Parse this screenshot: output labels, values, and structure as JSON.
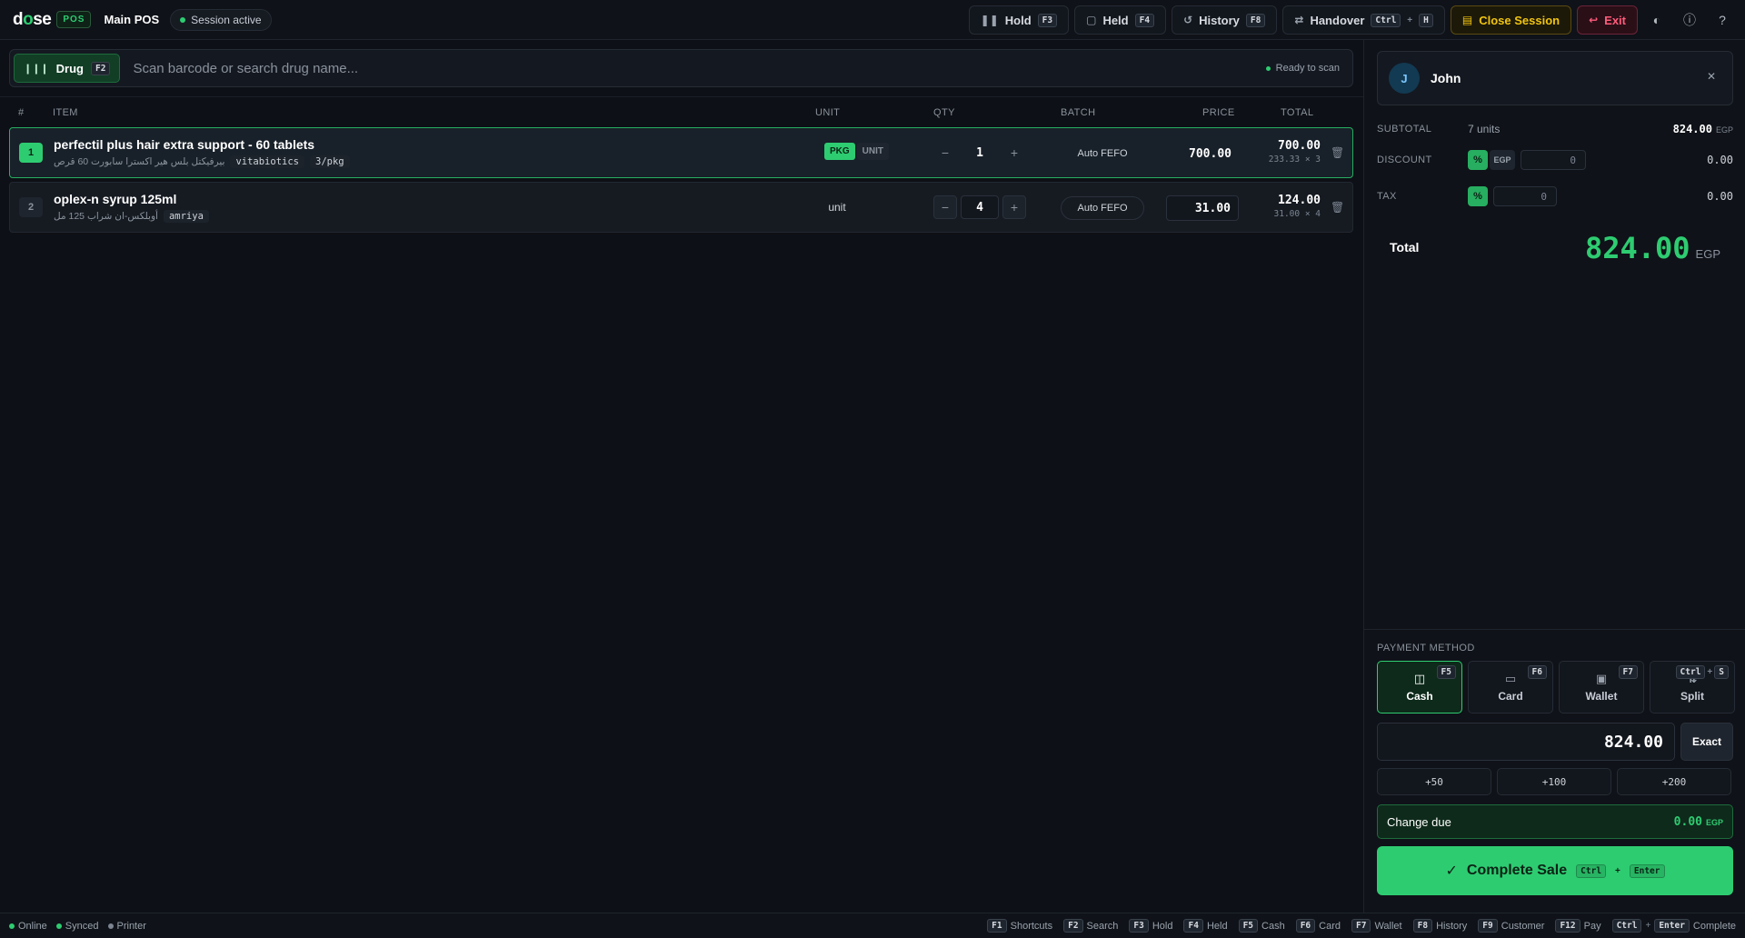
{
  "header": {
    "logo_pre": "d",
    "logo_o": "o",
    "logo_post": "se",
    "pos_badge": "POS",
    "title": "Main POS",
    "session": "Session active",
    "actions": {
      "hold": {
        "label": "Hold",
        "key": "F3"
      },
      "held": {
        "label": "Held",
        "key": "F4"
      },
      "history": {
        "label": "History",
        "key": "F8"
      },
      "handover": {
        "label": "Handover",
        "key1": "Ctrl",
        "plus": "+",
        "key2": "H"
      },
      "close_session": {
        "label": "Close Session"
      },
      "exit": {
        "label": "Exit"
      }
    }
  },
  "search": {
    "mode_label": "Drug",
    "mode_key": "F2",
    "placeholder": "Scan barcode or search drug name...",
    "status": "Ready to scan"
  },
  "table": {
    "headers": {
      "num": "#",
      "item": "ITEM",
      "unit": "UNIT",
      "qty": "QTY",
      "batch": "BATCH",
      "price": "PRICE",
      "total": "TOTAL"
    },
    "rows": [
      {
        "index": "1",
        "name": "perfectil plus hair extra support - 60 tablets",
        "arabic": "بيرفيكتل بلس هير اكسترا سابورت 60 قرص",
        "manufacturer": "vitabiotics",
        "pack": "3/pkg",
        "unit_on": "PKG",
        "unit_off": "UNIT",
        "qty": "1",
        "batch": "Auto FEFO",
        "price": "700.00",
        "total": "700.00",
        "breakdown": "233.33 × 3"
      },
      {
        "index": "2",
        "name": "oplex-n syrup 125ml",
        "arabic": "أوبلكس-ان شراب 125 مل",
        "manufacturer": "amriya",
        "unit": "unit",
        "qty": "4",
        "batch": "Auto FEFO",
        "price": "31.00",
        "total": "124.00",
        "breakdown": "31.00 × 4"
      }
    ]
  },
  "customer": {
    "initial": "J",
    "name": "John"
  },
  "summary": {
    "subtotal_label": "SUBTOTAL",
    "units": "7 units",
    "subtotal": "824.00",
    "currency": "EGP",
    "discount_label": "DISCOUNT",
    "discount_mode": "%",
    "discount_currency": "EGP",
    "discount_input": "0",
    "discount_value": "0.00",
    "tax_label": "TAX",
    "tax_mode": "%",
    "tax_input": "0",
    "tax_value": "0.00",
    "total_label": "Total",
    "total": "824.00"
  },
  "payment": {
    "title": "PAYMENT METHOD",
    "methods": [
      {
        "label": "Cash",
        "key": "F5",
        "icon": "cash-icon"
      },
      {
        "label": "Card",
        "key": "F6",
        "icon": "card-icon"
      },
      {
        "label": "Wallet",
        "key": "F7",
        "icon": "wallet-icon"
      },
      {
        "label": "Split",
        "key1": "Ctrl",
        "plus": "+",
        "key2": "S",
        "icon": "split-icon"
      }
    ],
    "tendered": "824.00",
    "exact_label": "Exact",
    "quick": [
      "+50",
      "+100",
      "+200"
    ],
    "change_label": "Change due",
    "change_value": "0.00",
    "change_currency": "EGP",
    "complete_label": "Complete Sale",
    "complete_key1": "Ctrl",
    "complete_plus": "+",
    "complete_key2": "Enter"
  },
  "status": {
    "online": "Online",
    "synced": "Synced",
    "printer": "Printer",
    "shortcuts": [
      {
        "key": "F1",
        "label": "Shortcuts"
      },
      {
        "key": "F2",
        "label": "Search"
      },
      {
        "key": "F3",
        "label": "Hold"
      },
      {
        "key": "F4",
        "label": "Held"
      },
      {
        "key": "F5",
        "label": "Cash"
      },
      {
        "key": "F6",
        "label": "Card"
      },
      {
        "key": "F7",
        "label": "Wallet"
      },
      {
        "key": "F8",
        "label": "History"
      },
      {
        "key": "F9",
        "label": "Customer"
      },
      {
        "key": "F12",
        "label": "Pay"
      }
    ],
    "complete_key1": "Ctrl",
    "complete_plus": "+",
    "complete_key2": "Enter",
    "complete_label": "Complete"
  },
  "colors": {
    "accent": "#2ecc71",
    "background": "#0d1016",
    "warning": "#f1c40f",
    "danger": "#ff5c7a"
  }
}
